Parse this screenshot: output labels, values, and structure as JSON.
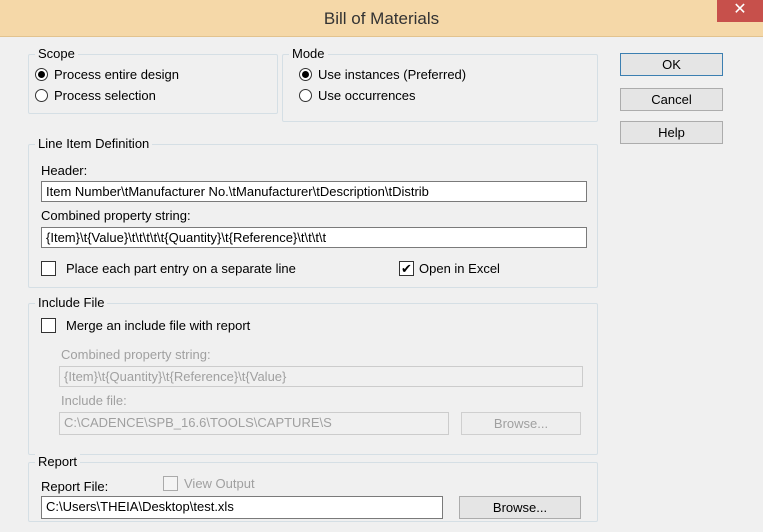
{
  "window": {
    "title": "Bill of Materials",
    "close_glyph": "✕"
  },
  "scope": {
    "title": "Scope",
    "options": [
      {
        "label": "Process entire design",
        "selected": true
      },
      {
        "label": "Process selection",
        "selected": false
      }
    ]
  },
  "mode": {
    "title": "Mode",
    "options": [
      {
        "label": "Use instances (Preferred)",
        "selected": true
      },
      {
        "label": "Use occurrences",
        "selected": false
      }
    ]
  },
  "buttons": {
    "ok": "OK",
    "cancel": "Cancel",
    "help": "Help"
  },
  "line_item": {
    "title": "Line Item Definition",
    "header_label": "Header:",
    "header_value": "Item Number\\tManufacturer No.\\tManufacturer\\tDescription\\tDistrib",
    "combined_label": "Combined property string:",
    "combined_value": "{Item}\\t{Value}\\t\\t\\t\\t\\t{Quantity}\\t{Reference}\\t\\t\\t\\t",
    "separate_line_label": "Place each part entry on a separate line",
    "separate_line_checked": false,
    "open_excel_label": "Open in Excel",
    "open_excel_checked": true
  },
  "include_file": {
    "title": "Include File",
    "merge_label": "Merge an include file with report",
    "merge_checked": false,
    "combined_label": "Combined property string:",
    "combined_value": "{Item}\\t{Quantity}\\t{Reference}\\t{Value}",
    "include_label": "Include file:",
    "include_value": "C:\\CADENCE\\SPB_16.6\\TOOLS\\CAPTURE\\S",
    "browse": "Browse..."
  },
  "report": {
    "title": "Report",
    "report_file_label": "Report File:",
    "view_output_label": "View Output",
    "view_output_checked": false,
    "file_value": "C:\\Users\\THEIA\\Desktop\\test.xls",
    "browse": "Browse..."
  },
  "check_glyph": "✔"
}
